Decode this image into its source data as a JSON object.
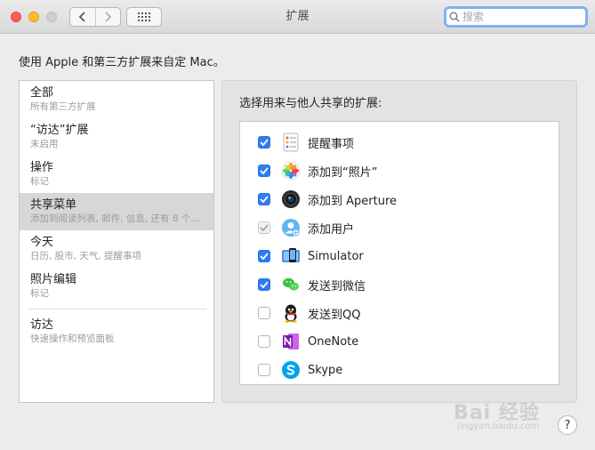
{
  "window": {
    "title": "扩展"
  },
  "search": {
    "placeholder": "搜索"
  },
  "intro": "使用 Apple 和第三方扩展来自定 Mac。",
  "sidebar": {
    "items": [
      {
        "name": "全部",
        "sub": "所有第三方扩展"
      },
      {
        "name": "“访达”扩展",
        "sub": "未启用"
      },
      {
        "name": "操作",
        "sub": "标记"
      },
      {
        "name": "共享菜单",
        "sub": "添加到阅读列表, 邮件, 信息, 还有 8 个…",
        "selected": true
      },
      {
        "name": "今天",
        "sub": "日历, 股市, 天气, 提醒事项"
      },
      {
        "name": "照片编辑",
        "sub": "标记"
      },
      {
        "name": "访达",
        "sub": "快速操作和预览面板"
      }
    ]
  },
  "panel": {
    "label": "选择用来与他人共享的扩展:",
    "rows": [
      {
        "label": "提醒事项",
        "checked": true,
        "icon": "reminders-icon"
      },
      {
        "label": "添加到“照片”",
        "checked": true,
        "icon": "photos-icon"
      },
      {
        "label": "添加到 Aperture",
        "checked": true,
        "icon": "aperture-icon"
      },
      {
        "label": "添加用户",
        "checked": true,
        "disabled": true,
        "icon": "add-user-icon"
      },
      {
        "label": "Simulator",
        "checked": true,
        "icon": "simulator-icon"
      },
      {
        "label": "发送到微信",
        "checked": true,
        "icon": "wechat-icon"
      },
      {
        "label": "发送到QQ",
        "checked": false,
        "icon": "qq-icon"
      },
      {
        "label": "OneNote",
        "checked": false,
        "icon": "onenote-icon"
      },
      {
        "label": "Skype",
        "checked": false,
        "icon": "skype-icon"
      }
    ]
  },
  "help": {
    "label": "?"
  },
  "watermark": {
    "brand": "Bai 经验",
    "url": "jingyan.baidu.com"
  }
}
